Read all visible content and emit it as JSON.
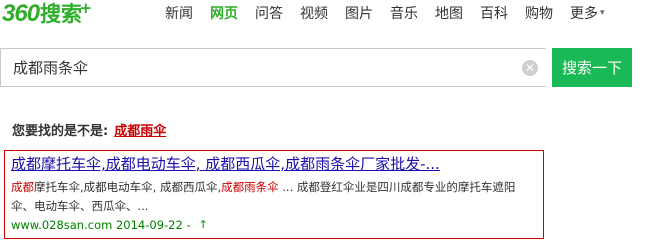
{
  "logo": {
    "num": "360",
    "cn": "搜索",
    "plus": "+"
  },
  "nav": {
    "items": [
      "新闻",
      "网页",
      "问答",
      "视频",
      "图片",
      "音乐",
      "地图",
      "百科",
      "购物"
    ],
    "active_index": 1,
    "more_label": "更多"
  },
  "search": {
    "value": "成都雨条伞",
    "button_label": "搜索一下"
  },
  "suggest": {
    "prefix": "您要找的是不是:",
    "term": "成都雨伞"
  },
  "result": {
    "title": "成都摩托车伞,成都电动车伞, 成都西瓜伞,成都雨条伞厂家批发-...",
    "snippet_parts": [
      {
        "t": "成都",
        "hl": true
      },
      {
        "t": "摩托车伞,成都电动车伞, 成都西瓜伞,",
        "hl": false
      },
      {
        "t": "成都雨条伞",
        "hl": true
      },
      {
        "t": " ... 成都登红伞业是四川成都专业的摩托车遮阳伞、电动车伞、西瓜伞、...",
        "hl": false
      }
    ],
    "url": "www.028san.com 2014-09-22 -"
  },
  "colors": {
    "brand": "#2fae2a",
    "button": "#19b955",
    "highlight": "#cc0000",
    "link": "#1a0dab",
    "url": "#008000"
  }
}
